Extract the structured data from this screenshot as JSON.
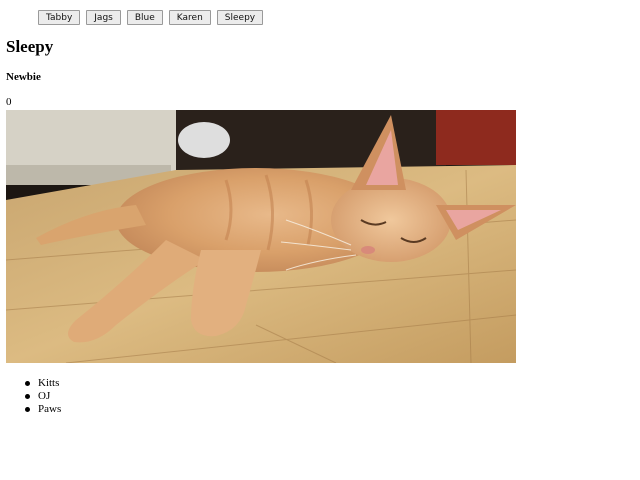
{
  "nav": {
    "buttons": [
      "Tabby",
      "Jags",
      "Blue",
      "Karen",
      "Sleepy"
    ]
  },
  "cat": {
    "name": "Sleepy",
    "level": "Newbie",
    "click_count": "0"
  },
  "nicknames": [
    "Kitts",
    "OJ",
    "Paws"
  ]
}
